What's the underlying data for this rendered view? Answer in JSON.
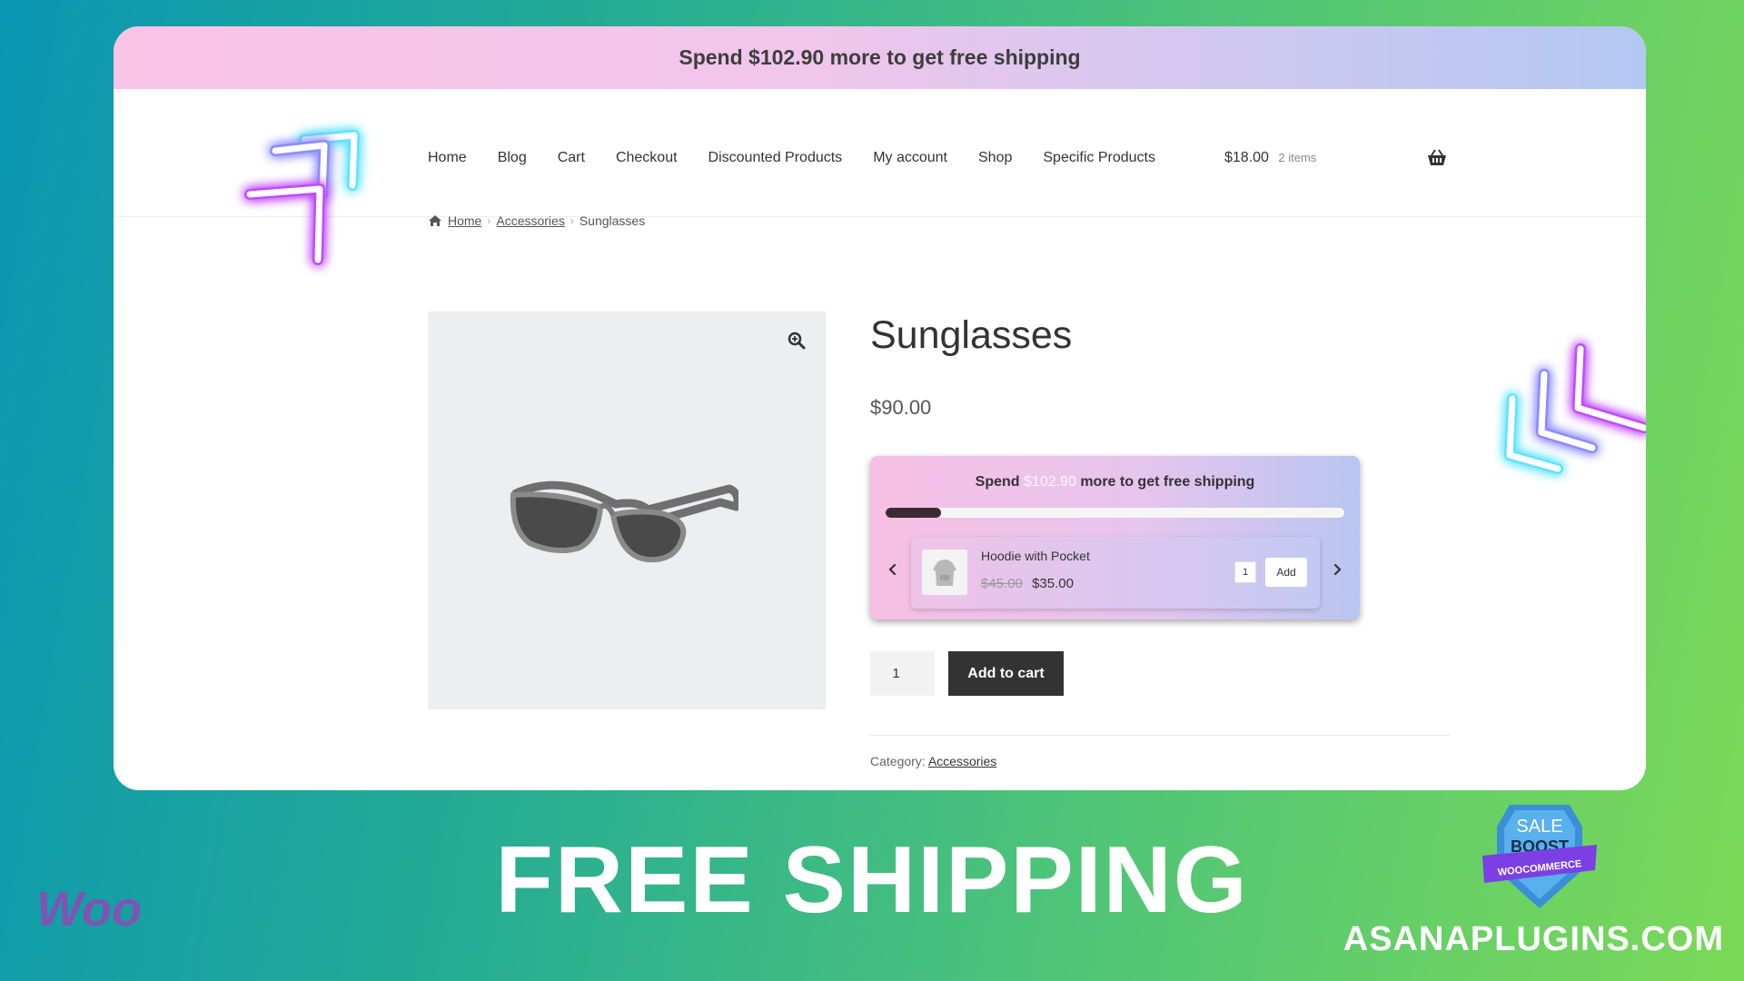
{
  "top_banner": {
    "text": "Spend $102.90 more to get free shipping"
  },
  "nav": {
    "items": [
      "Home",
      "Blog",
      "Cart",
      "Checkout",
      "Discounted Products",
      "My account",
      "Shop",
      "Specific Products"
    ],
    "cart_total": "$18.00",
    "cart_items": "2 items",
    "cart_icon": "basket-icon"
  },
  "breadcrumb": {
    "home_icon": "home-icon",
    "home": "Home",
    "category": "Accessories",
    "current": "Sunglasses"
  },
  "product": {
    "title": "Sunglasses",
    "price": "$90.00",
    "quantity": "1",
    "add_to_cart": "Add to cart",
    "category_label": "Category:",
    "category": "Accessories"
  },
  "free_shipping_widget": {
    "msg_prefix": "Spend",
    "amount": "$102.90",
    "msg_suffix": "more to get free shipping",
    "progress": 0.12,
    "bar_fill_color": "#3b2a33",
    "suggestion": {
      "name": "Hoodie with Pocket",
      "old_price": "$45.00",
      "price": "$35.00",
      "quantity": "1",
      "add_label": "Add"
    }
  },
  "promo": {
    "headline": "FREE SHIPPING",
    "brand_logo": "Woo",
    "badge_line1": "SALE",
    "badge_line2": "BOOST",
    "badge_ribbon": "WOOCOMMERCE",
    "site": "ASANAPLUGINS.COM"
  },
  "colors": {
    "accent_dark": "#333333",
    "woo_purple": "#7f54b3"
  }
}
